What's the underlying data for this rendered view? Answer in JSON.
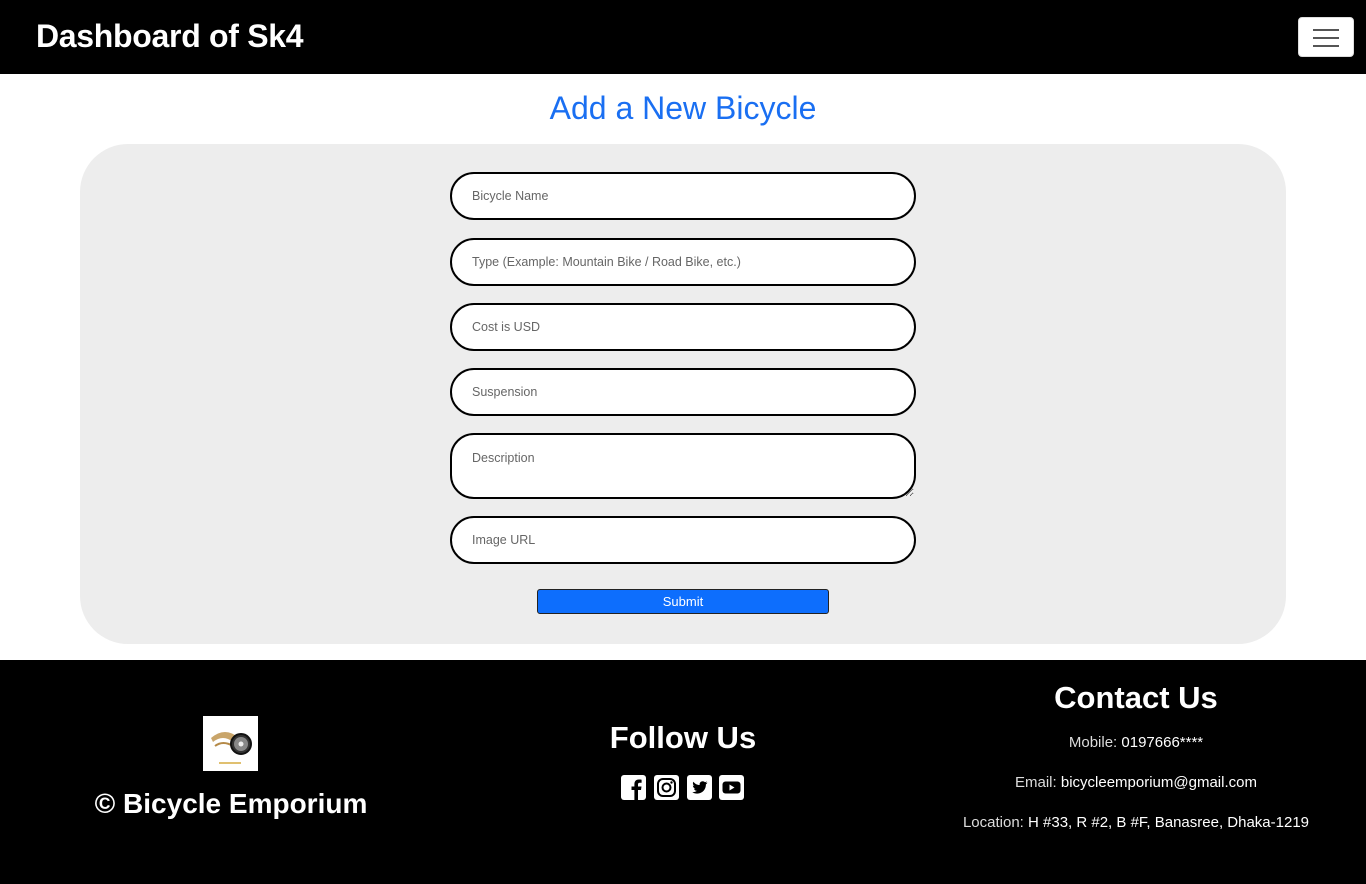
{
  "navbar": {
    "brand": "Dashboard of Sk4",
    "menu_icon": "hamburger-menu-icon"
  },
  "page": {
    "title": "Add a New Bicycle"
  },
  "form": {
    "name_placeholder": "Bicycle Name",
    "type_placeholder": "Type (Example: Mountain Bike / Road Bike, etc.)",
    "cost_placeholder": "Cost is USD",
    "suspension_placeholder": "Suspension",
    "description_placeholder": "Description",
    "image_placeholder": "Image URL",
    "submit_label": "Submit"
  },
  "footer": {
    "copyright": "© Bicycle Emporium",
    "follow_title": "Follow Us",
    "socials": [
      "facebook-icon",
      "instagram-icon",
      "twitter-icon",
      "youtube-icon"
    ],
    "contact_title": "Contact Us",
    "mobile_label": "Mobile:",
    "mobile_value": "0197666****",
    "email_label": "Email:",
    "email_value": "bicycleemporium@gmail.com",
    "location_label": "Location:",
    "location_value": "H #33, R #2, B #F, Banasree, Dhaka-1219"
  },
  "colors": {
    "accent": "#1a6ff2",
    "button": "#0d6efd",
    "panel": "#ededed",
    "navbar": "#000000"
  }
}
